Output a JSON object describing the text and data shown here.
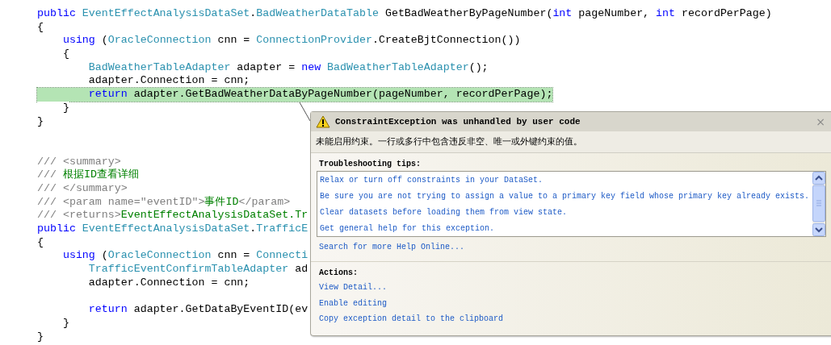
{
  "editor": {
    "methods": [
      {
        "groups": [
          {
            "lines": [
              {
                "highlighted": false,
                "tokens": [
                  {
                    "kind": "keyword",
                    "text": "public"
                  },
                  {
                    "kind": "type",
                    "text": " EventEffectAnalysisDataSet"
                  },
                  {
                    "kind": "plain",
                    "text": "."
                  },
                  {
                    "kind": "type",
                    "text": "BadWeatherDataTable"
                  },
                  {
                    "kind": "plain",
                    "text": " GetBadWeatherByPageNumber("
                  },
                  {
                    "kind": "keyword",
                    "text": "int"
                  },
                  {
                    "kind": "plain",
                    "text": " pageNumber, "
                  },
                  {
                    "kind": "keyword",
                    "text": "int"
                  },
                  {
                    "kind": "plain",
                    "text": " recordPerPage)"
                  }
                ]
              },
              {
                "highlighted": false,
                "tokens": [
                  {
                    "kind": "plain",
                    "text": "{"
                  }
                ]
              },
              {
                "highlighted": false,
                "tokens": [
                  {
                    "kind": "keyword",
                    "text": "    using"
                  },
                  {
                    "kind": "plain",
                    "text": " ("
                  },
                  {
                    "kind": "type",
                    "text": "OracleConnection"
                  },
                  {
                    "kind": "plain",
                    "text": " cnn = "
                  },
                  {
                    "kind": "type",
                    "text": "ConnectionProvider"
                  },
                  {
                    "kind": "plain",
                    "text": ".CreateBjtConnection())"
                  }
                ]
              },
              {
                "highlighted": false,
                "tokens": [
                  {
                    "kind": "plain",
                    "text": "    {"
                  }
                ]
              },
              {
                "highlighted": false,
                "tokens": [
                  {
                    "kind": "type",
                    "text": "        BadWeatherTableAdapter"
                  },
                  {
                    "kind": "plain",
                    "text": " adapter = "
                  },
                  {
                    "kind": "keyword",
                    "text": "new"
                  },
                  {
                    "kind": "type",
                    "text": " BadWeatherTableAdapter"
                  },
                  {
                    "kind": "plain",
                    "text": "();"
                  }
                ]
              },
              {
                "highlighted": false,
                "tokens": [
                  {
                    "kind": "plain",
                    "text": "        adapter.Connection = cnn;"
                  }
                ]
              },
              {
                "highlighted": true,
                "tokens": [
                  {
                    "kind": "keyword",
                    "text": "        return"
                  },
                  {
                    "kind": "plain",
                    "text": " adapter.GetBadWeatherDataByPageNumber(pageNumber, recordPerPage);"
                  }
                ]
              },
              {
                "highlighted": false,
                "tokens": [
                  {
                    "kind": "plain",
                    "text": "    }"
                  }
                ]
              },
              {
                "highlighted": false,
                "tokens": [
                  {
                    "kind": "plain",
                    "text": "}"
                  }
                ]
              }
            ]
          }
        ]
      },
      {
        "groups": [
          {
            "lines": [
              {
                "highlighted": false,
                "tokens": [
                  {
                    "kind": "comment",
                    "text": "/// <summary>"
                  }
                ]
              },
              {
                "highlighted": false,
                "tokens": [
                  {
                    "kind": "comment",
                    "text": "/// "
                  },
                  {
                    "kind": "comment-text",
                    "text": "根据ID查看详细"
                  }
                ]
              },
              {
                "highlighted": false,
                "tokens": [
                  {
                    "kind": "comment",
                    "text": "/// </summary>"
                  }
                ]
              },
              {
                "highlighted": false,
                "tokens": [
                  {
                    "kind": "comment",
                    "text": "/// <param name=\"eventID\">"
                  },
                  {
                    "kind": "comment-text",
                    "text": "事件ID"
                  },
                  {
                    "kind": "comment",
                    "text": "</param>"
                  }
                ]
              },
              {
                "highlighted": false,
                "tokens": [
                  {
                    "kind": "comment",
                    "text": "/// <returns>"
                  },
                  {
                    "kind": "comment-text",
                    "text": "EventEffectAnalysisDataSet.Tr"
                  }
                ]
              },
              {
                "highlighted": false,
                "tokens": [
                  {
                    "kind": "keyword",
                    "text": "public"
                  },
                  {
                    "kind": "type",
                    "text": " EventEffectAnalysisDataSet"
                  },
                  {
                    "kind": "plain",
                    "text": "."
                  },
                  {
                    "kind": "type",
                    "text": "TrafficE"
                  }
                ]
              },
              {
                "highlighted": false,
                "tokens": [
                  {
                    "kind": "plain",
                    "text": "{"
                  }
                ]
              },
              {
                "highlighted": false,
                "tokens": [
                  {
                    "kind": "keyword",
                    "text": "    using"
                  },
                  {
                    "kind": "plain",
                    "text": " ("
                  },
                  {
                    "kind": "type",
                    "text": "OracleConnection"
                  },
                  {
                    "kind": "plain",
                    "text": " cnn = "
                  },
                  {
                    "kind": "type",
                    "text": "Connecti"
                  }
                ]
              },
              {
                "highlighted": false,
                "tokens": [
                  {
                    "kind": "type",
                    "text": "        TrafficEventConfirmTableAdapter"
                  },
                  {
                    "kind": "plain",
                    "text": " ad"
                  }
                ]
              },
              {
                "highlighted": false,
                "tokens": [
                  {
                    "kind": "plain",
                    "text": "        adapter.Connection = cnn;"
                  }
                ]
              }
            ]
          },
          {
            "lines": [
              {
                "highlighted": false,
                "tokens": [
                  {
                    "kind": "keyword",
                    "text": "        return"
                  },
                  {
                    "kind": "plain",
                    "text": " adapter.GetDataByEventID(ev"
                  }
                ]
              },
              {
                "highlighted": false,
                "tokens": [
                  {
                    "kind": "plain",
                    "text": "    }"
                  }
                ]
              },
              {
                "highlighted": false,
                "tokens": [
                  {
                    "kind": "plain",
                    "text": "}"
                  }
                ]
              }
            ]
          }
        ]
      }
    ]
  },
  "exception_popup": {
    "title": "ConstraintException was unhandled by user code",
    "close_button": "×",
    "message": "未能启用约束。一行或多行中包含违反非空、唯一或外键约束的值。",
    "tips_heading": "Troubleshooting tips:",
    "tips": [
      "Relax or turn off constraints in your DataSet.",
      "Be sure you are not trying to assign a value to a primary key field whose primary key already exists.",
      "Clear datasets before loading them from view state.",
      "Get general help for this exception."
    ],
    "search_link": "Search for more Help Online...",
    "actions_heading": "Actions:",
    "actions": [
      "View Detail...",
      "Enable editing",
      "Copy exception detail to the clipboard"
    ]
  }
}
